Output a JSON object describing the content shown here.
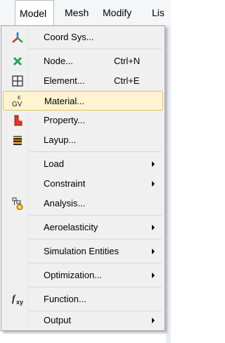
{
  "menubar": {
    "items": [
      "Model",
      "Mesh",
      "Modify",
      "Lis"
    ]
  },
  "menu": {
    "items": [
      {
        "label": "Coord Sys...",
        "shortcut": "",
        "icon": "coord-sys-icon",
        "submenu": false
      },
      {
        "label": "Node...",
        "shortcut": "Ctrl+N",
        "icon": "node-icon",
        "submenu": false
      },
      {
        "label": "Element...",
        "shortcut": "Ctrl+E",
        "icon": "element-icon",
        "submenu": false
      },
      {
        "label": "Material...",
        "shortcut": "",
        "icon": "material-icon",
        "submenu": false,
        "highlighted": true
      },
      {
        "label": "Property...",
        "shortcut": "",
        "icon": "property-icon",
        "submenu": false
      },
      {
        "label": "Layup...",
        "shortcut": "",
        "icon": "layup-icon",
        "submenu": false
      },
      {
        "label": "Load",
        "shortcut": "",
        "icon": "",
        "submenu": true
      },
      {
        "label": "Constraint",
        "shortcut": "",
        "icon": "",
        "submenu": true
      },
      {
        "label": "Analysis...",
        "shortcut": "",
        "icon": "analysis-icon",
        "submenu": false
      },
      {
        "label": "Aeroelasticity",
        "shortcut": "",
        "icon": "",
        "submenu": true
      },
      {
        "label": "Simulation Entities",
        "shortcut": "",
        "icon": "",
        "submenu": true
      },
      {
        "label": "Optimization...",
        "shortcut": "",
        "icon": "",
        "submenu": true
      },
      {
        "label": "Function...",
        "shortcut": "",
        "icon": "function-icon",
        "submenu": false
      },
      {
        "label": "Output",
        "shortcut": "",
        "icon": "",
        "submenu": true
      }
    ]
  },
  "icons": {
    "material_glyph_top": "E",
    "material_glyph_bottom": "GV",
    "function_glyph": "f",
    "function_sub": "xy"
  },
  "colors": {
    "highlight_bg": "#fff4cf",
    "highlight_border": "#e5c365",
    "menu_bg": "#f0f0f0"
  }
}
